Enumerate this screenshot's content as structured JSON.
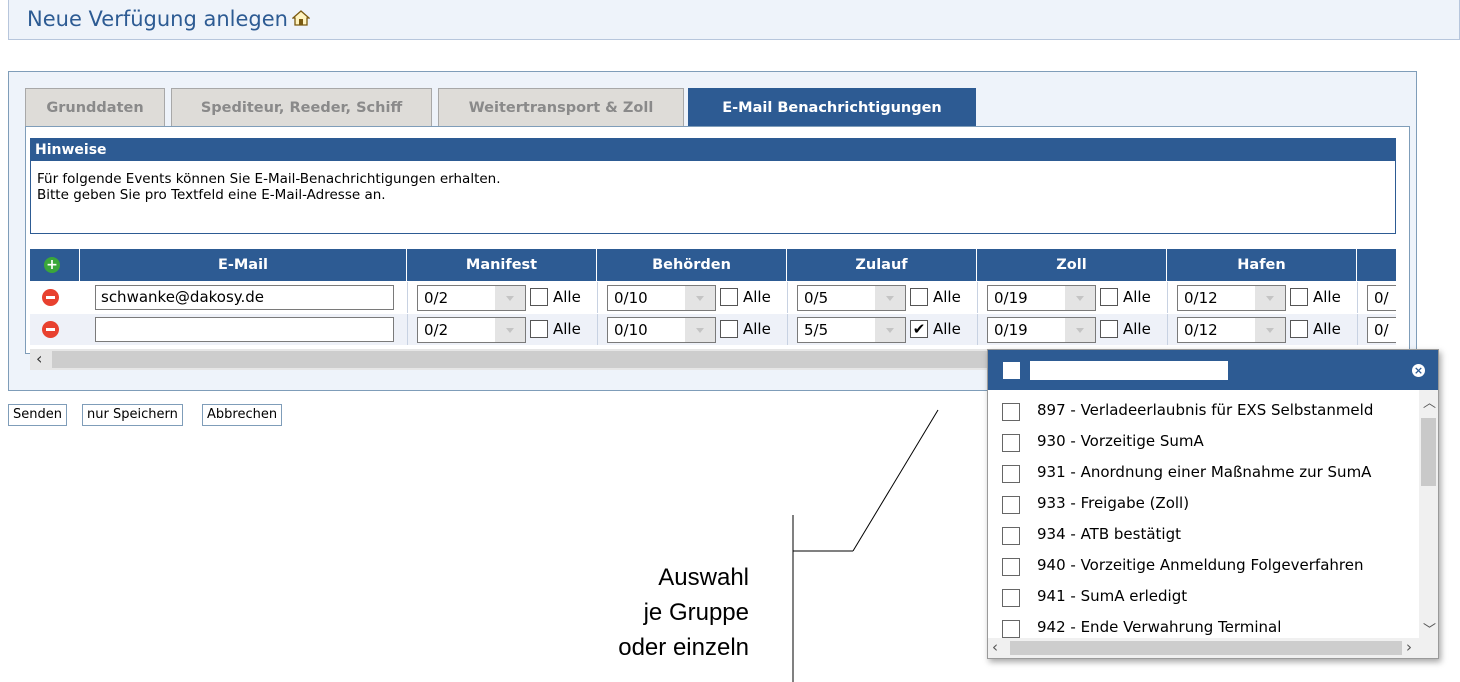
{
  "header": {
    "title": "Neue Verfügung anlegen"
  },
  "tabs": [
    {
      "label": "Grunddaten",
      "active": false
    },
    {
      "label": "Spediteur, Reeder, Schiff",
      "active": false
    },
    {
      "label": "Weitertransport & Zoll",
      "active": false
    },
    {
      "label": "E-Mail Benachrichtigungen",
      "active": true
    }
  ],
  "hinweise": {
    "title": "Hinweise",
    "line1": "Für folgende Events können Sie E-Mail-Benachrichtigungen erhalten.",
    "line2": "Bitte geben Sie pro Textfeld eine E-Mail-Adresse an."
  },
  "grid": {
    "columns": [
      "E-Mail",
      "Manifest",
      "Behörden",
      "Zulauf",
      "Zoll",
      "Hafen"
    ],
    "alle_label": "Alle",
    "rows": [
      {
        "email": "schwanke@dakosy.de",
        "values": [
          "0/2",
          "0/10",
          "0/5",
          "0/19",
          "0/12",
          "0/"
        ],
        "alle": [
          false,
          false,
          false,
          false,
          false
        ]
      },
      {
        "email": "",
        "values": [
          "0/2",
          "0/10",
          "5/5",
          "0/19",
          "0/12",
          "0/"
        ],
        "alle": [
          false,
          false,
          true,
          false,
          false
        ]
      }
    ]
  },
  "buttons": {
    "send": "Senden",
    "save": "nur Speichern",
    "cancel": "Abbrechen"
  },
  "popup": {
    "items": [
      "897 - Verladeerlaubnis für EXS Selbstanmeld",
      "930 - Vorzeitige SumA",
      "931 - Anordnung einer Maßnahme zur SumA",
      "933 - Freigabe (Zoll)",
      "934 - ATB bestätigt",
      "940 - Vorzeitige Anmeldung Folgeverfahren",
      "941 - SumA erledigt",
      "942 - Ende Verwahrung Terminal"
    ]
  },
  "annotation": {
    "line1": "Auswahl",
    "line2": "je Gruppe",
    "line3": "oder einzeln"
  },
  "colors": {
    "primary": "#2d5b93",
    "panel": "#eef3fa",
    "add": "#3aa63a",
    "remove": "#e8412f"
  }
}
